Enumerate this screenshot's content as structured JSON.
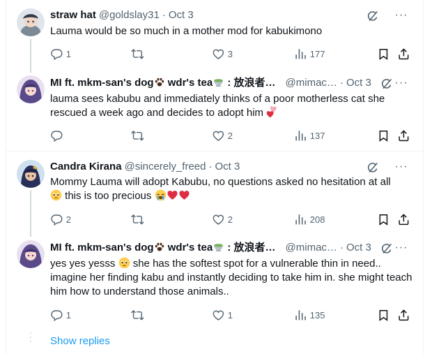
{
  "tweets": [
    {
      "name": "straw hat",
      "handle": "@goldslay31",
      "date": "Oct 3",
      "text": "Lauma would be so much in a mother mod for kabukimono",
      "replies": "1",
      "retweets": "",
      "likes": "3",
      "views": "177"
    },
    {
      "name": "MI ft. mkm-san's dog",
      "name_suffix": " wdr's tea",
      "name_suffix2": " : 放浪者…",
      "handle": "@mimac…",
      "date": "Oct 3",
      "text": "lauma sees kabubu and immediately thinks of a poor motherless cat she rescued a week ago and decides to adopt him",
      "replies": "",
      "retweets": "",
      "likes": "2",
      "views": "137"
    },
    {
      "name": "Candra Kirana",
      "handle": "@sincerely_freed",
      "date": "Oct 3",
      "text": "Mommy Lauma will adopt Kabubu, no questions asked no hesitation at all",
      "text2": " this is too precious ",
      "replies": "2",
      "retweets": "",
      "likes": "2",
      "views": "208"
    },
    {
      "name": "MI ft. mkm-san's dog",
      "name_suffix": " wdr's tea",
      "name_suffix2": " : 放浪者…",
      "handle": "@mimac…",
      "date": "Oct 3",
      "text": "yes yes yesss",
      "text2": " she has the softest spot for a vulnerable thin in need.. imagine her finding kabu and instantly deciding to take him in. she might teach him how to understand those animals..",
      "replies": "1",
      "retweets": "",
      "likes": "1",
      "views": "135"
    }
  ],
  "show_replies": "Show replies",
  "colors": {
    "accent": "#1d9bf0",
    "secondary": "#536471",
    "text": "#0f1419",
    "heart": "#e0245e"
  },
  "icons": [
    "reply-icon",
    "retweet-icon",
    "like-icon",
    "views-icon",
    "bookmark-icon",
    "share-icon",
    "grok-icon",
    "more-icon",
    "paw-icon",
    "tea-icon",
    "heart-emoji",
    "crying-emoji",
    "pleading-emoji"
  ]
}
